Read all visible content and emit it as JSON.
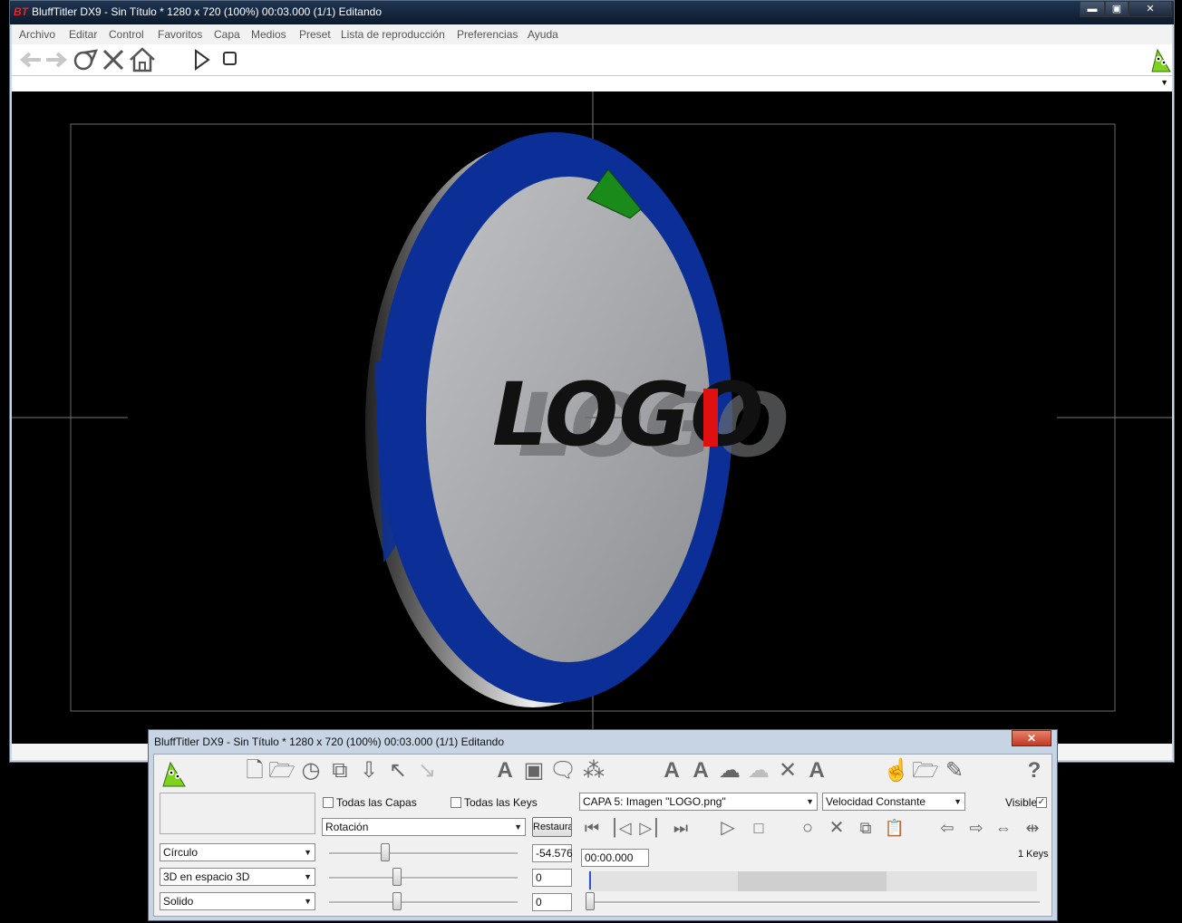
{
  "main_window": {
    "title": "BluffTitler DX9 - Sin Título * 1280 x 720 (100%) 00:03.000 (1/1) Editando",
    "controls": {
      "minimize": "▬",
      "maximize": "▣",
      "close": "✕"
    }
  },
  "menu": {
    "items": [
      "Archivo",
      "Editar",
      "Control",
      "Favoritos",
      "Capa",
      "Medios",
      "Preset",
      "Lista de reproducción",
      "Preferencias",
      "Ayuda"
    ]
  },
  "toolbar": {
    "icons": [
      "arrow-left-icon",
      "arrow-right-icon",
      "redo-icon",
      "close-x-icon",
      "home-icon",
      "play-icon",
      "stop-icon",
      "mascot-icon"
    ]
  },
  "viewport": {
    "logo_text": "LOGO",
    "colors": {
      "ring": "#0b2f96",
      "face": "#b4b6b9",
      "gizmo_green": "#1a8a1a",
      "gizmo_red": "#e01010"
    }
  },
  "dialog": {
    "title": "BluffTitler DX9 - Sin Título * 1280 x 720 (100%) 00:03.000 (1/1) Editando",
    "close": "✕",
    "todas_capas_label": "Todas las Capas",
    "todas_keys_label": "Todas las Keys",
    "layer_select": "CAPA 5: Imagen \"LOGO.png\"",
    "speed_select": "Velocidad Constante",
    "visible_label": "Visible",
    "visible_checked": "✓",
    "property_select": "Rotación",
    "restore_button": "Restaura",
    "shape_select": "Círculo",
    "mode_select": "3D en espacio 3D",
    "render_select": "Solido",
    "value1": "-54.576",
    "value2": "0",
    "value3": "0",
    "time_value": "00:00.000",
    "keys_count": "1 Keys",
    "sliders": [
      0.3,
      0.36,
      0.36
    ]
  }
}
